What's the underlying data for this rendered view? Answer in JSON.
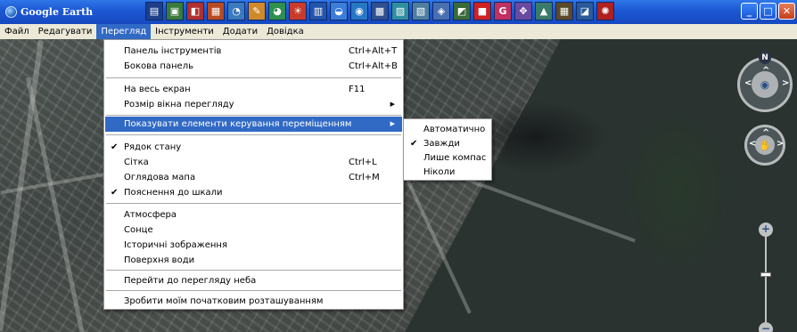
{
  "window": {
    "title": "Google Earth",
    "controls": {
      "minimize": "_",
      "maximize": "□",
      "close": "✕"
    }
  },
  "toolbar": {
    "icons": [
      {
        "name": "sidebar-toggle-icon",
        "glyph": "▤",
        "color": "#1d3f8a"
      },
      {
        "name": "placemark-icon",
        "glyph": "▣",
        "color": "#3a7a3a"
      },
      {
        "name": "polygon-icon",
        "glyph": "◧",
        "color": "#b03030"
      },
      {
        "name": "path-icon",
        "glyph": "▦",
        "color": "#b84a22"
      },
      {
        "name": "image-overlay-icon",
        "glyph": "◔",
        "color": "#3a7abf"
      },
      {
        "name": "record-tour-icon",
        "glyph": "✎",
        "color": "#d08a2a"
      },
      {
        "name": "historical-imagery-icon",
        "glyph": "◕",
        "color": "#2f8f4f"
      },
      {
        "name": "sunlight-icon",
        "glyph": "☀",
        "color": "#c83a2a"
      },
      {
        "name": "sky-switch-icon",
        "glyph": "▥",
        "color": "#2255aa"
      },
      {
        "name": "ruler-icon",
        "glyph": "◒",
        "color": "#3b7dd8"
      },
      {
        "name": "globe-icon",
        "glyph": "◉",
        "color": "#2877c4"
      },
      {
        "name": "email-icon",
        "glyph": "▩",
        "color": "#2f4f8f"
      },
      {
        "name": "print-icon",
        "glyph": "▨",
        "color": "#2f8f9f"
      },
      {
        "name": "save-image-icon",
        "glyph": "▧",
        "color": "#4f7f9f"
      },
      {
        "name": "maps-icon",
        "glyph": "◈",
        "color": "#4a6fb0"
      },
      {
        "name": "layers-icon",
        "glyph": "◩",
        "color": "#3a6a3a"
      },
      {
        "name": "flag-icon",
        "glyph": "■",
        "color": "#d02020"
      },
      {
        "name": "g-icon",
        "glyph": "G",
        "color": "#c03060"
      },
      {
        "name": "tools-icon",
        "glyph": "✥",
        "color": "#6a4aa0"
      },
      {
        "name": "network-icon",
        "glyph": "▲",
        "color": "#3a7a6a"
      },
      {
        "name": "gallery-icon",
        "glyph": "▦",
        "color": "#5a4a2a"
      },
      {
        "name": "view-icon",
        "glyph": "◪",
        "color": "#2a5a9a"
      },
      {
        "name": "sun-icon",
        "glyph": "✺",
        "color": "#b02020"
      }
    ]
  },
  "menubar": {
    "items": [
      "Файл",
      "Редагувати",
      "Перегляд",
      "Інструменти",
      "Додати",
      "Довідка"
    ],
    "active": "Перегляд"
  },
  "view_menu": {
    "items": {
      "toolbar": {
        "label": "Панель інструментів",
        "shortcut": "Ctrl+Alt+T"
      },
      "sidebar": {
        "label": "Бокова панель",
        "shortcut": "Ctrl+Alt+B"
      },
      "fullscreen": {
        "label": "На весь екран",
        "shortcut": "F11"
      },
      "window_size": {
        "label": "Розмір вікна перегляду"
      },
      "show_nav": {
        "label": "Показувати елементи керування переміщенням"
      },
      "status_bar": {
        "label": "Рядок стану",
        "checked": true
      },
      "grid": {
        "label": "Сітка",
        "shortcut": "Ctrl+L"
      },
      "overview_map": {
        "label": "Оглядова мапа",
        "shortcut": "Ctrl+M"
      },
      "scale_legend": {
        "label": "Пояснення до шкали",
        "checked": true
      },
      "atmosphere": {
        "label": "Атмосфера"
      },
      "sun": {
        "label": "Сонце"
      },
      "historical": {
        "label": "Історичні зображення"
      },
      "water_surface": {
        "label": "Поверхня води"
      },
      "switch_sky": {
        "label": "Перейти до перегляду неба"
      },
      "make_start": {
        "label": "Зробити моїм початковим розташуванням"
      }
    },
    "check_glyph": "✔",
    "submenu_glyph": "▶"
  },
  "nav_submenu": {
    "items": {
      "automatic": {
        "label": "Автоматично"
      },
      "always": {
        "label": "Завжди",
        "checked": true
      },
      "compass_only": {
        "label": "Лише компас"
      },
      "never": {
        "label": "Ніколи"
      }
    }
  },
  "navigation": {
    "north_label": "N",
    "zoom_in": "+",
    "zoom_out": "−",
    "zoom_level": 0.45
  },
  "colors": {
    "titlebar": "#1c57d3",
    "menu_highlight": "#316ac5",
    "menubar_bg": "#ece9d8"
  }
}
